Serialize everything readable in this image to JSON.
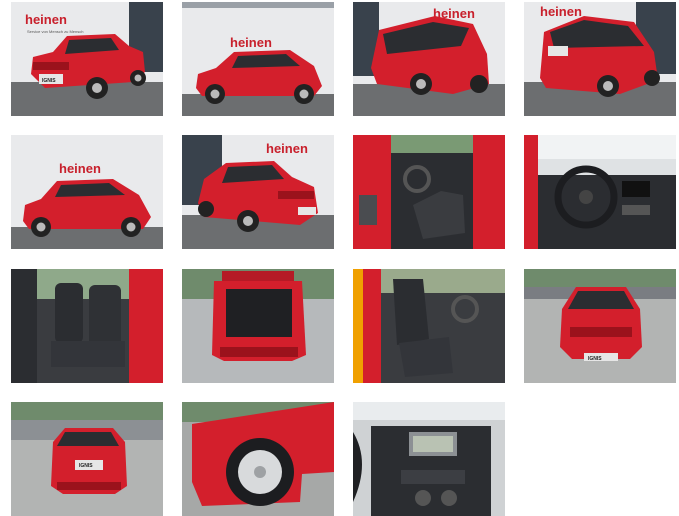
{
  "gallery": {
    "brand": {
      "logo_text": "heinen",
      "logo_slogan": "Service von Mensch zu Mensch"
    },
    "car": {
      "model_badge": "IGNIS",
      "colors": {
        "body": "#d31f2c",
        "body_dark": "#9b121c",
        "interior": "#2b2d31",
        "floor": "#6c6e70",
        "wall": "#e9eaec"
      }
    },
    "photos": [
      {
        "view": "front-three-quarter-left"
      },
      {
        "view": "side-profile-left"
      },
      {
        "view": "rear-three-quarter-left"
      },
      {
        "view": "rear-three-quarter-right"
      },
      {
        "view": "side-profile-left-2"
      },
      {
        "view": "front-three-quarter-right"
      },
      {
        "view": "driver-door-open-interior"
      },
      {
        "view": "dashboard-steering-wheel"
      },
      {
        "view": "rear-seats"
      },
      {
        "view": "trunk-open"
      },
      {
        "view": "front-seats"
      },
      {
        "view": "front-outdoor"
      },
      {
        "view": "rear-outdoor"
      },
      {
        "view": "front-wheel-closeup"
      },
      {
        "view": "center-console-closeup"
      }
    ]
  }
}
